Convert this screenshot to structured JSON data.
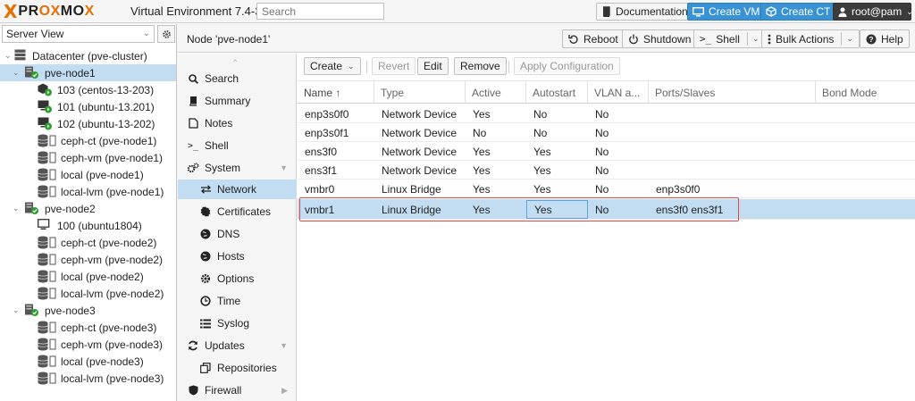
{
  "header": {
    "logo_word_pre": "PR",
    "logo_word_ox": "OX",
    "logo_word_mo": "MO",
    "logo_word_x": "X",
    "version": "Virtual Environment 7.4-3",
    "search_placeholder": "Search",
    "documentation": "Documentation",
    "create_vm": "Create VM",
    "create_ct": "Create CT",
    "user": "root@pam"
  },
  "tree": {
    "view": "Server View",
    "items": [
      {
        "label": "Datacenter (pve-cluster)",
        "icon": "datacenter-icon"
      },
      {
        "label": "pve-node1",
        "icon": "server-online-icon"
      },
      {
        "label": "103 (centos-13-203)",
        "icon": "container-running-icon"
      },
      {
        "label": "101 (ubuntu-13.201)",
        "icon": "vm-running-icon"
      },
      {
        "label": "102 (ubuntu-13-202)",
        "icon": "vm-running-icon"
      },
      {
        "label": "ceph-ct (pve-node1)",
        "icon": "storage-icon"
      },
      {
        "label": "ceph-vm (pve-node1)",
        "icon": "storage-icon"
      },
      {
        "label": "local (pve-node1)",
        "icon": "storage-icon"
      },
      {
        "label": "local-lvm (pve-node1)",
        "icon": "storage-icon"
      },
      {
        "label": "pve-node2",
        "icon": "server-online-icon"
      },
      {
        "label": "100 (ubuntu1804)",
        "icon": "vm-stopped-icon"
      },
      {
        "label": "ceph-ct (pve-node2)",
        "icon": "storage-icon"
      },
      {
        "label": "ceph-vm (pve-node2)",
        "icon": "storage-icon"
      },
      {
        "label": "local (pve-node2)",
        "icon": "storage-icon"
      },
      {
        "label": "local-lvm (pve-node2)",
        "icon": "storage-icon"
      },
      {
        "label": "pve-node3",
        "icon": "server-online-icon"
      },
      {
        "label": "ceph-ct (pve-node3)",
        "icon": "storage-icon"
      },
      {
        "label": "ceph-vm (pve-node3)",
        "icon": "storage-icon"
      },
      {
        "label": "local (pve-node3)",
        "icon": "storage-icon"
      },
      {
        "label": "local-lvm (pve-node3)",
        "icon": "storage-icon"
      }
    ]
  },
  "node": {
    "title": "Node 'pve-node1'",
    "reboot": "Reboot",
    "shutdown": "Shutdown",
    "shell": "Shell",
    "bulk": "Bulk Actions",
    "help": "Help"
  },
  "menu": {
    "items": [
      {
        "label": "Search",
        "icon": "search-icon"
      },
      {
        "label": "Summary",
        "icon": "book-icon"
      },
      {
        "label": "Notes",
        "icon": "notes-icon"
      },
      {
        "label": "Shell",
        "icon": "terminal-icon"
      },
      {
        "label": "System",
        "icon": "cogs-icon"
      },
      {
        "label": "Network",
        "icon": "exchange-icon"
      },
      {
        "label": "Certificates",
        "icon": "certificate-icon"
      },
      {
        "label": "DNS",
        "icon": "globe-icon"
      },
      {
        "label": "Hosts",
        "icon": "globe-icon"
      },
      {
        "label": "Options",
        "icon": "gear-icon"
      },
      {
        "label": "Time",
        "icon": "clock-icon"
      },
      {
        "label": "Syslog",
        "icon": "list-icon"
      },
      {
        "label": "Updates",
        "icon": "refresh-icon"
      },
      {
        "label": "Repositories",
        "icon": "files-icon"
      },
      {
        "label": "Firewall",
        "icon": "shield-icon"
      }
    ]
  },
  "toolbar": {
    "create": "Create",
    "revert": "Revert",
    "edit": "Edit",
    "remove": "Remove",
    "apply": "Apply Configuration"
  },
  "grid": {
    "columns": [
      "Name ↑",
      "Type",
      "Active",
      "Autostart",
      "VLAN a...",
      "Ports/Slaves",
      "Bond Mode"
    ],
    "rows": [
      [
        "enp3s0f0",
        "Network Device",
        "Yes",
        "No",
        "No",
        "",
        ""
      ],
      [
        "enp3s0f1",
        "Network Device",
        "No",
        "No",
        "No",
        "",
        ""
      ],
      [
        "ens3f0",
        "Network Device",
        "Yes",
        "Yes",
        "No",
        "",
        ""
      ],
      [
        "ens3f1",
        "Network Device",
        "Yes",
        "Yes",
        "No",
        "",
        ""
      ],
      [
        "vmbr0",
        "Linux Bridge",
        "Yes",
        "Yes",
        "No",
        "enp3s0f0",
        ""
      ],
      [
        "vmbr1",
        "Linux Bridge",
        "Yes",
        "Yes",
        "No",
        "ens3f0 ens3f1",
        ""
      ]
    ]
  }
}
